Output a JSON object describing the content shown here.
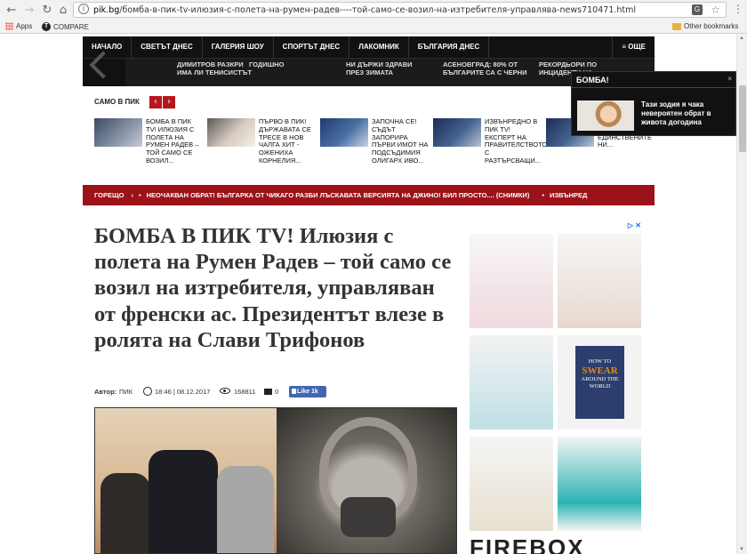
{
  "browser": {
    "url_host": "pik.bg",
    "url_path": "/бомба-в-пик-tv-илюзия-с-полета-на-румен-радев----той-само-се-возил-на-изтребителя-управлява-news710471.html",
    "bookmarks": [
      "Apps",
      "COMPARE",
      "Other bookmarks"
    ]
  },
  "nav": {
    "items": [
      "НАЧАЛО",
      "СВЕТЪТ ДНЕС",
      "ГАЛЕРИЯ ШОУ",
      "СПОРТЪТ ДНЕС",
      "ЛАКОМНИК",
      "БЪЛГАРИЯ ДНЕС"
    ],
    "more": "≡ ОЩЕ"
  },
  "subnav": [
    "ДИМИТРОВ РАЗКРИ ИМА ЛИ ТЕНИСИСТЪТ",
    "ГОДИШНО",
    "НИ ДЪРЖИ ЗДРАВИ ПРЕЗ ЗИМАТА",
    "АСЕНОВГРАД: 80% ОТ БЪЛГАРИТЕ СА С ЧЕРНИ",
    "РЕКОРДЬОРИ ПО ИНЦИДЕНТИ НА..."
  ],
  "related": {
    "label": "САМО В ПИК",
    "prev": "‹",
    "next": "›",
    "items": [
      "БОМБА В ПИК TV! Илюзия с полета на Румен Радев – той само се возил...",
      "ПЪРВО В ПИК! Държавата се тресе в нов чалга хит - оженихa Корнелия...",
      "ЗАПОЧНА СЕ! Съдът запорира първи имот на подсъдимия олигарх Иво...",
      "ИЗВЪНРЕДНО В ПИК TV! Експерт на правителството с разтърсващи...",
      "...на Румен Радев приземи единствените ни..."
    ]
  },
  "toast": {
    "title": "БОМБА!",
    "close": "×",
    "text": "Тази зодия я чака невероятен обрат в живота догодина"
  },
  "breaking": {
    "label": "ГОРЕЩО",
    "text": "НЕОЧАКВАН ОБРАТ! БЪЛГАРКА ОТ ЧИКАГО РАЗБИ ЛЪСКАВАТА ВЕРСИЯТА НА ДЖИНО! БИЛ ПРОСТО.... (СНИМКИ)",
    "next": "ИЗВЪНРЕД"
  },
  "article": {
    "title": "БОМБА В ПИК TV! Илюзия с полета на Румен Радев – той само се возил на изтребителя, управляван от френски ас. Президентът влезе в ролята на Слави Трифонов",
    "author_label": "Автор:",
    "author": "ПИК",
    "time": "18:46 | 08.12.2017",
    "views": "168811",
    "comments": "0",
    "like": "Like 1k"
  },
  "ad": {
    "adchoices": "▷ ✕",
    "brand": "FIREBOX",
    "book_pre": "HOW TO",
    "book_main": "SWEAR",
    "book_post": "AROUND THE WORLD"
  }
}
